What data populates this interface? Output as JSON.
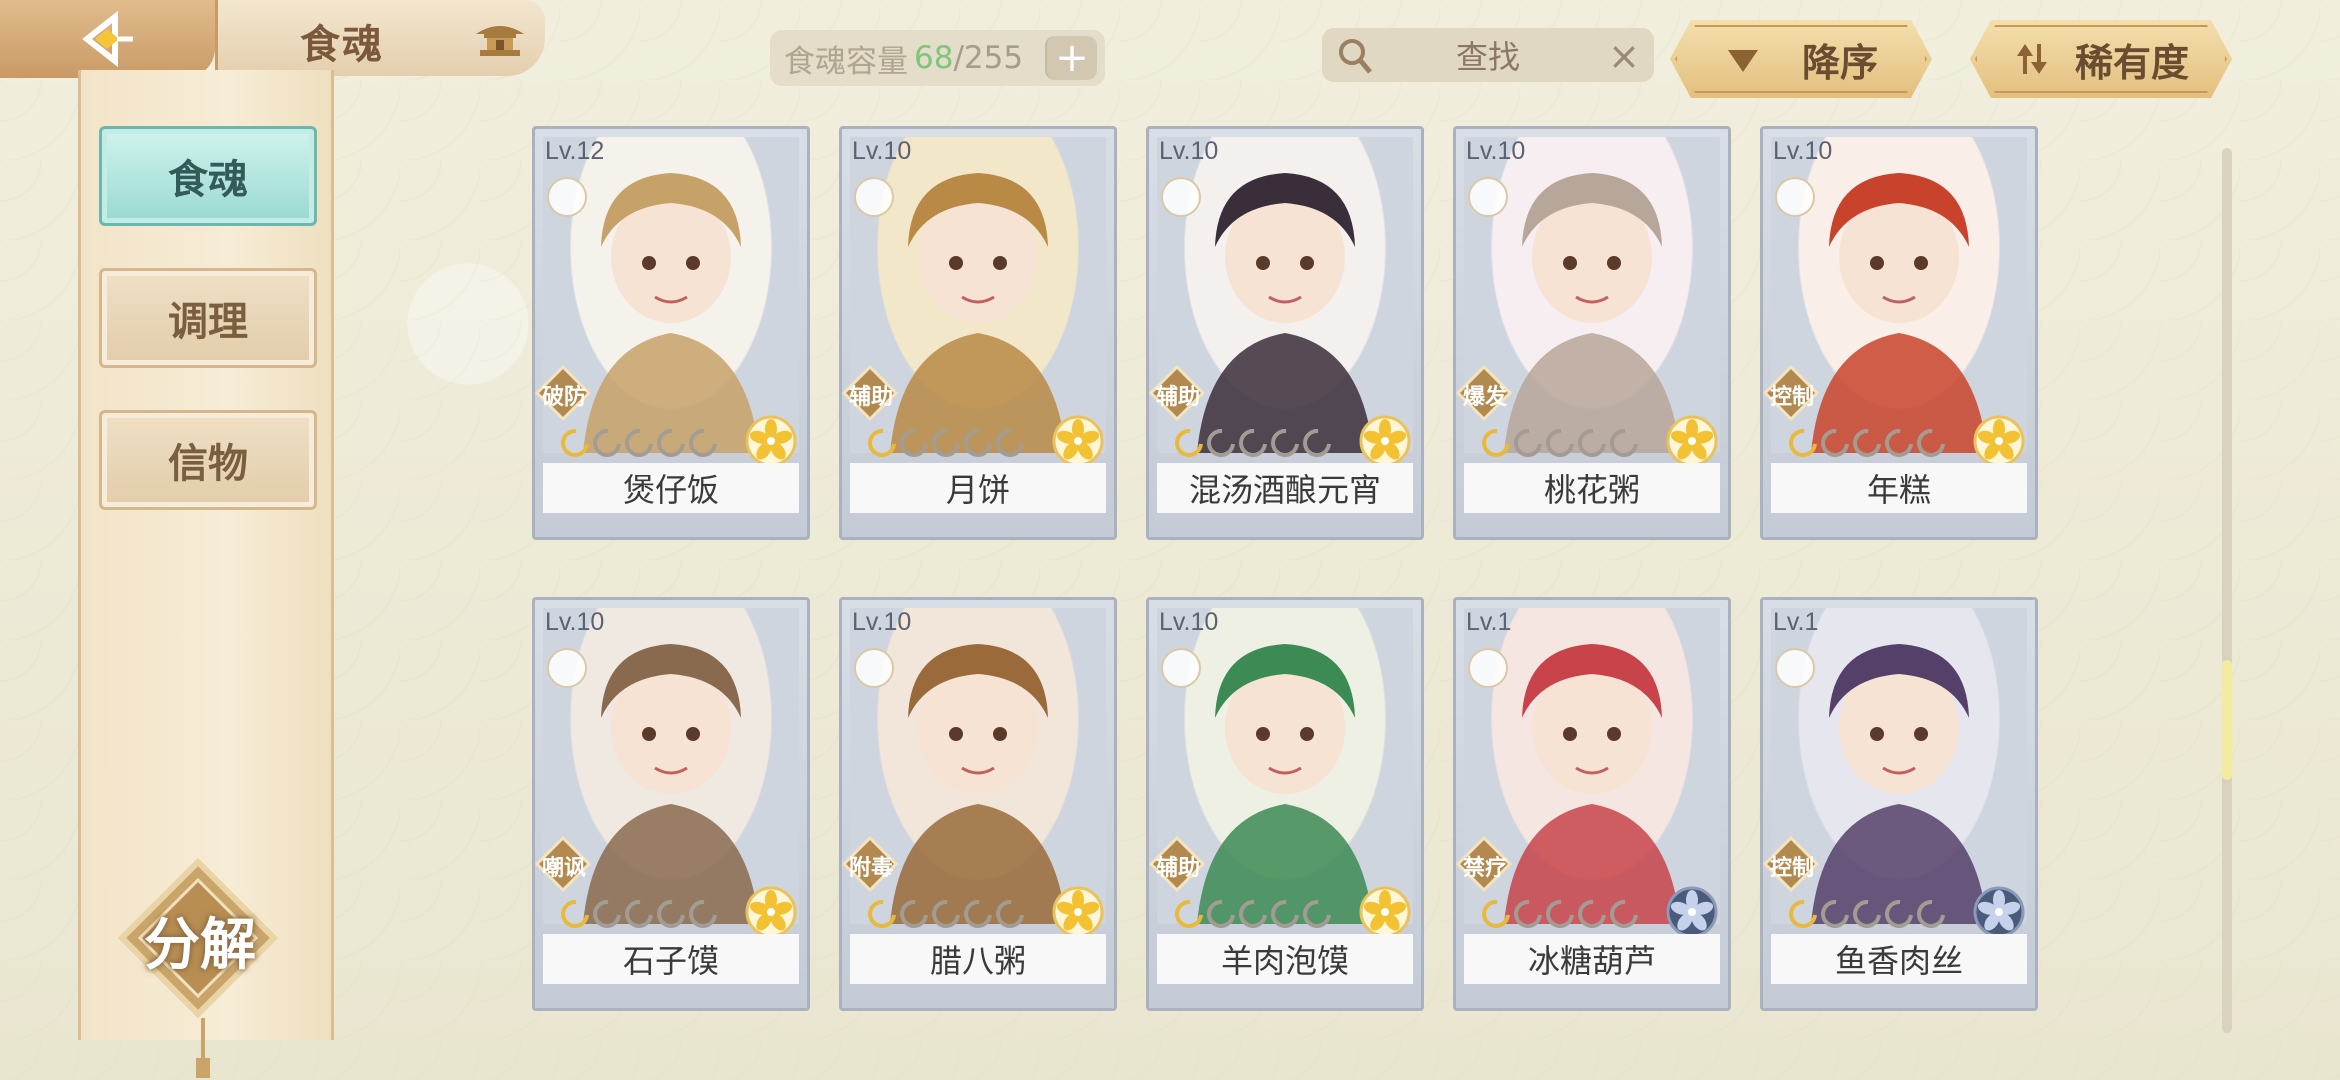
{
  "header": {
    "title": "食魂",
    "capacity_label": "食魂容量",
    "capacity_current": "68",
    "capacity_max": "/255",
    "plus_label": "+",
    "search_text": "查找",
    "clear_label": "×",
    "sort_order_label": "降序",
    "sort_key_label": "稀有度"
  },
  "sidebar": {
    "tabs": [
      {
        "label": "食魂",
        "active": true
      },
      {
        "label": "调理",
        "active": false
      },
      {
        "label": "信物",
        "active": false
      }
    ],
    "decompose_label": "分解"
  },
  "cards": [
    {
      "level": "Lv.12",
      "role": "破防",
      "name": "煲仔饭",
      "stars": 1,
      "rarity": "gold"
    },
    {
      "level": "Lv.10",
      "role": "辅助",
      "name": "月饼",
      "stars": 1,
      "rarity": "gold"
    },
    {
      "level": "Lv.10",
      "role": "辅助",
      "name": "混汤酒酿元宵",
      "stars": 1,
      "rarity": "gold"
    },
    {
      "level": "Lv.10",
      "role": "爆发",
      "name": "桃花粥",
      "stars": 1,
      "rarity": "gold"
    },
    {
      "level": "Lv.10",
      "role": "控制",
      "name": "年糕",
      "stars": 1,
      "rarity": "gold"
    },
    {
      "level": "Lv.10",
      "role": "嘲讽",
      "name": "石子馍",
      "stars": 1,
      "rarity": "gold"
    },
    {
      "level": "Lv.10",
      "role": "附毒",
      "name": "腊八粥",
      "stars": 1,
      "rarity": "gold"
    },
    {
      "level": "Lv.10",
      "role": "辅助",
      "name": "羊肉泡馍",
      "stars": 1,
      "rarity": "gold"
    },
    {
      "level": "Lv.1",
      "role": "禁疗",
      "name": "冰糖葫芦",
      "stars": 1,
      "rarity": "blue"
    },
    {
      "level": "Lv.1",
      "role": "控制",
      "name": "鱼香肉丝",
      "stars": 1,
      "rarity": "blue"
    }
  ],
  "colors": {
    "capacity_current": "#7fc57a",
    "active_tab": "#98d9d0",
    "gold_rarity": "#f2c233",
    "blue_rarity": "#4a5a7a"
  }
}
